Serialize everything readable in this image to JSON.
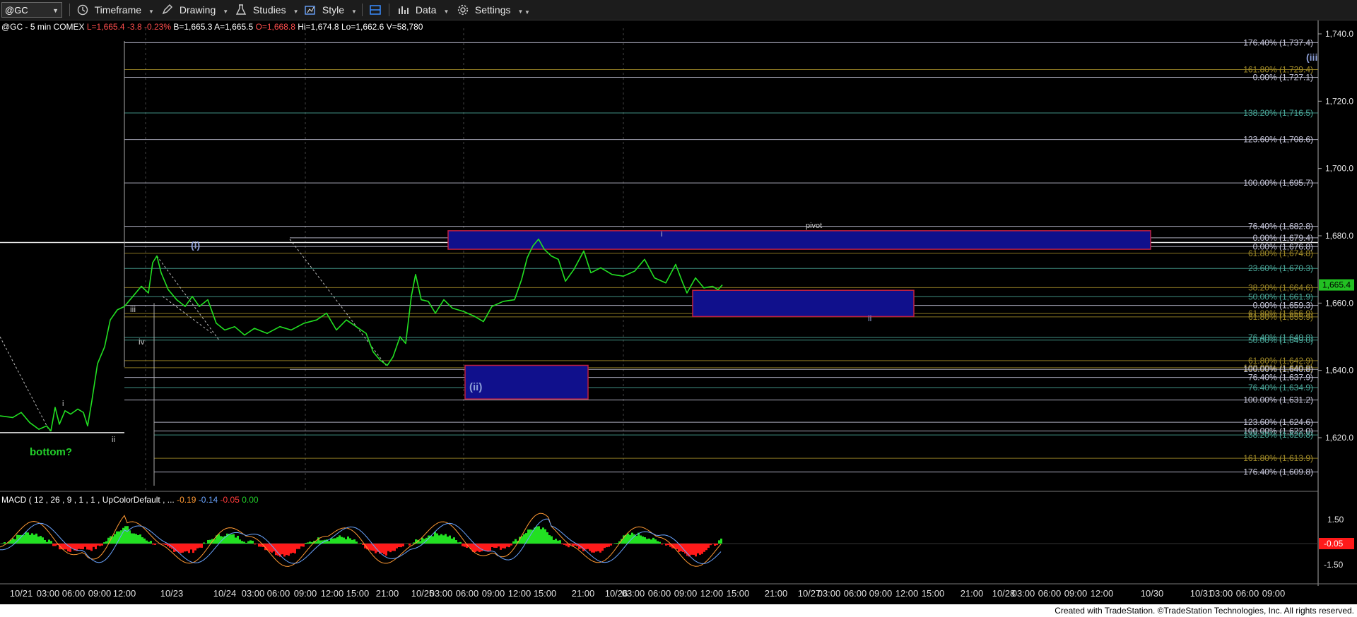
{
  "toolbar": {
    "symbol": "@GC",
    "timeframe": "Timeframe",
    "drawing": "Drawing",
    "studies": "Studies",
    "style": "Style",
    "data": "Data",
    "settings": "Settings"
  },
  "status": {
    "symbol_info": "@GC - 5 min COMEX",
    "last": "L=1,665.4",
    "change": "-3.8",
    "pct": "-0.23%",
    "bid": "B=1,665.3",
    "ask": "A=1,665.5",
    "open": "O=1,668.8",
    "high": "Hi=1,674.8",
    "low": "Lo=1,662.6",
    "volume": "V=58,780"
  },
  "macd": {
    "label": "MACD ( 12 , 26 , 9 , 1 , 1 , UpColorDefault , ...",
    "v1": "-0.19",
    "v2": "-0.14",
    "v3": "-0.05",
    "v4": "0.00",
    "axis_top": "1.50",
    "axis_bottom": "-1.50",
    "current": "-0.05"
  },
  "footer": "Created with TradeStation. ©TradeStation Technologies, Inc. All rights reserved.",
  "chart_data": {
    "type": "line",
    "price_axis": {
      "min": 1600,
      "max": 1744,
      "ticks": [
        "1,740.0",
        "1,720.0",
        "1,700.0",
        "1,680.0",
        "1,660.0",
        "1,640.0",
        "1,620.0"
      ],
      "tick_values": [
        1740,
        1720,
        1700,
        1680,
        1660,
        1640,
        1620
      ]
    },
    "current_price": {
      "value": 1665.4,
      "label": "1,665.4"
    },
    "time_labels": [
      "10/21",
      "03:00",
      "06:00",
      "09:00",
      "12:00",
      "10/23",
      "10/24",
      "03:00",
      "06:00",
      "09:00",
      "12:00",
      "15:00",
      "21:00",
      "10/25",
      "03:00",
      "06:00",
      "09:00",
      "12:00",
      "15:00",
      "21:00",
      "10/26",
      "03:00",
      "06:00",
      "09:00",
      "12:00",
      "15:00",
      "21:00",
      "10/27",
      "03:00",
      "06:00",
      "09:00",
      "12:00",
      "15:00",
      "21:00",
      "10/28",
      "03:00",
      "06:00",
      "09:00",
      "12:00",
      "10/30",
      "10/31",
      "03:00",
      "06:00",
      "09:00"
    ],
    "series": [
      {
        "color": "#22e022",
        "points": [
          [
            0,
            1626.5
          ],
          [
            18,
            1626.0
          ],
          [
            30,
            1627.5
          ],
          [
            42,
            1624.5
          ],
          [
            55,
            1622.5
          ],
          [
            66,
            1623.5
          ],
          [
            72,
            1622.0
          ],
          [
            78,
            1629.0
          ],
          [
            84,
            1624.0
          ],
          [
            92,
            1628.0
          ],
          [
            100,
            1627.0
          ],
          [
            110,
            1628.5
          ],
          [
            118,
            1627.5
          ],
          [
            124,
            1623.5
          ],
          [
            130,
            1631.0
          ],
          [
            138,
            1642.0
          ],
          [
            148,
            1647.0
          ],
          [
            156,
            1655.0
          ],
          [
            166,
            1658.0
          ],
          [
            176,
            1659.0
          ],
          [
            188,
            1662.0
          ],
          [
            200,
            1665.0
          ],
          [
            210,
            1663.0
          ],
          [
            216,
            1672.0
          ],
          [
            222,
            1674.0
          ],
          [
            228,
            1669.0
          ],
          [
            238,
            1664.0
          ],
          [
            250,
            1661.0
          ],
          [
            262,
            1659.0
          ],
          [
            272,
            1662.0
          ],
          [
            282,
            1659.0
          ],
          [
            294,
            1661.0
          ],
          [
            306,
            1654.0
          ],
          [
            318,
            1652.0
          ],
          [
            332,
            1653.0
          ],
          [
            346,
            1650.5
          ],
          [
            360,
            1652.5
          ],
          [
            378,
            1651.0
          ],
          [
            396,
            1653.0
          ],
          [
            412,
            1652.0
          ],
          [
            430,
            1654.0
          ],
          [
            448,
            1655.0
          ],
          [
            462,
            1657.0
          ],
          [
            476,
            1652.0
          ],
          [
            490,
            1655.0
          ],
          [
            504,
            1653.0
          ],
          [
            518,
            1651.0
          ],
          [
            528,
            1645.5
          ],
          [
            538,
            1643.0
          ],
          [
            548,
            1641.5
          ],
          [
            556,
            1644.0
          ],
          [
            566,
            1650.0
          ],
          [
            574,
            1648.0
          ],
          [
            582,
            1662.0
          ],
          [
            588,
            1668.5
          ],
          [
            596,
            1661.0
          ],
          [
            606,
            1660.5
          ],
          [
            616,
            1657.0
          ],
          [
            628,
            1661.0
          ],
          [
            640,
            1658.5
          ],
          [
            656,
            1657.5
          ],
          [
            672,
            1656.0
          ],
          [
            684,
            1654.5
          ],
          [
            696,
            1659.0
          ],
          [
            712,
            1660.5
          ],
          [
            728,
            1661.0
          ],
          [
            738,
            1667.0
          ],
          [
            746,
            1673.5
          ],
          [
            754,
            1677.0
          ],
          [
            762,
            1679.0
          ],
          [
            770,
            1676.0
          ],
          [
            780,
            1674.0
          ],
          [
            790,
            1673.0
          ],
          [
            800,
            1666.5
          ],
          [
            812,
            1670.0
          ],
          [
            826,
            1675.5
          ],
          [
            836,
            1669.0
          ],
          [
            850,
            1670.5
          ],
          [
            866,
            1668.5
          ],
          [
            882,
            1668.0
          ],
          [
            898,
            1669.5
          ],
          [
            912,
            1673.0
          ],
          [
            926,
            1667.5
          ],
          [
            942,
            1666.0
          ],
          [
            956,
            1671.5
          ],
          [
            966,
            1666.0
          ],
          [
            972,
            1663.0
          ],
          [
            984,
            1667.5
          ],
          [
            996,
            1664.5
          ],
          [
            1008,
            1665.0
          ],
          [
            1016,
            1664.0
          ],
          [
            1022,
            1665.4
          ]
        ]
      }
    ],
    "fib_labels": [
      {
        "text": "176.40% (1,737.4)",
        "price": 1737.4,
        "color": "#c8c8dc"
      },
      {
        "text": "161.80% (1,729.4)",
        "price": 1729.4,
        "color": "#a08a28"
      },
      {
        "text": "0.00% (1,727.1)",
        "price": 1727.1,
        "color": "#c8c8dc"
      },
      {
        "text": "138.20% (1,716.5)",
        "price": 1716.5,
        "color": "#4aa89a"
      },
      {
        "text": "123.60% (1,708.6)",
        "price": 1708.6,
        "color": "#c8c8dc"
      },
      {
        "text": "100.00% (1,695.7)",
        "price": 1695.7,
        "color": "#c8c8dc"
      },
      {
        "text": "76.40% (1,682.8)",
        "price": 1682.8,
        "color": "#c8c8dc"
      },
      {
        "text": "0.00% (1,679.4)",
        "price": 1679.4,
        "color": "#c8c8dc"
      },
      {
        "text": "0.00% (1,676.8)",
        "price": 1676.8,
        "color": "#c8c8dc"
      },
      {
        "text": "61.80% (1,674.8)",
        "price": 1674.8,
        "color": "#a08a28"
      },
      {
        "text": "23.60% (1,670.3)",
        "price": 1670.3,
        "color": "#4aa89a"
      },
      {
        "text": "38.20% (1,664.6)",
        "price": 1664.6,
        "color": "#a08a28"
      },
      {
        "text": "50.00% (1,661.9)",
        "price": 1661.9,
        "color": "#4aa89a"
      },
      {
        "text": "0.00% (1,659.3)",
        "price": 1659.3,
        "color": "#c8c8dc"
      },
      {
        "text": "61.80% (1,656.9)",
        "price": 1656.9,
        "color": "#a08a28"
      },
      {
        "text": "61.80% (1,655.9)",
        "price": 1655.9,
        "color": "#a08a28"
      },
      {
        "text": "76.40% (1,649.8)",
        "price": 1649.8,
        "color": "#4aa89a"
      },
      {
        "text": "50.00% (1,649.0)",
        "price": 1649.0,
        "color": "#4aa89a"
      },
      {
        "text": "61.80% (1,642.9)",
        "price": 1642.9,
        "color": "#a08a28"
      },
      {
        "text": "100.00% (1,640.8)",
        "price": 1640.8,
        "color": "#a08a28"
      },
      {
        "text": "100.00% (1,640.8)",
        "price": 1640.3,
        "color": "#c8c8dc"
      },
      {
        "text": "76.40% (1,637.9)",
        "price": 1637.9,
        "color": "#c8c8dc"
      },
      {
        "text": "76.40% (1,634.9)",
        "price": 1634.9,
        "color": "#4aa89a"
      },
      {
        "text": "100.00% (1,631.2)",
        "price": 1631.2,
        "color": "#c8c8dc"
      },
      {
        "text": "123.60% (1,624.6)",
        "price": 1624.6,
        "color": "#c8c8dc"
      },
      {
        "text": "100.00% (1,622.0)",
        "price": 1622.0,
        "color": "#c8c8dc"
      },
      {
        "text": "138.20% (1,620.8)",
        "price": 1620.8,
        "color": "#4aa89a"
      },
      {
        "text": "161.80% (1,613.9)",
        "price": 1613.9,
        "color": "#a08a28"
      },
      {
        "text": "176.40% (1,609.8)",
        "price": 1609.8,
        "color": "#c8c8dc"
      }
    ],
    "wave_labels": [
      {
        "text": "(i)",
        "color": "#8ea0d8"
      },
      {
        "text": "iii",
        "color": "#c8c8c8"
      },
      {
        "text": "iv",
        "color": "#c8c8c8"
      },
      {
        "text": "i",
        "color": "#c8c8c8"
      },
      {
        "text": "ii",
        "color": "#c8c8c8"
      },
      {
        "text": "bottom?",
        "color": "#22d02a"
      },
      {
        "text": "(ii)",
        "color": "#8ea0d8"
      },
      {
        "text": "i",
        "color": "#c8c8c8"
      },
      {
        "text": "pivot",
        "color": "#c8c8c8"
      },
      {
        "text": "ii",
        "color": "#8ea0d8"
      },
      {
        "text": "(iii",
        "color": "#8ea0d8"
      }
    ],
    "zones": [
      {
        "name": "pivot-zone",
        "from": 1676.0,
        "to": 1681.5
      },
      {
        "name": "ii-target-zone",
        "from": 1656.0,
        "to": 1663.8
      },
      {
        "name": "ii-wave-zone",
        "from": 1631.5,
        "to": 1641.5
      }
    ],
    "colors": {
      "price": "#22e022",
      "zone_fill": "#10108c",
      "zone_border": "#c02040",
      "macd_pos": "#22e022",
      "macd_neg": "#ff1a1a"
    }
  }
}
